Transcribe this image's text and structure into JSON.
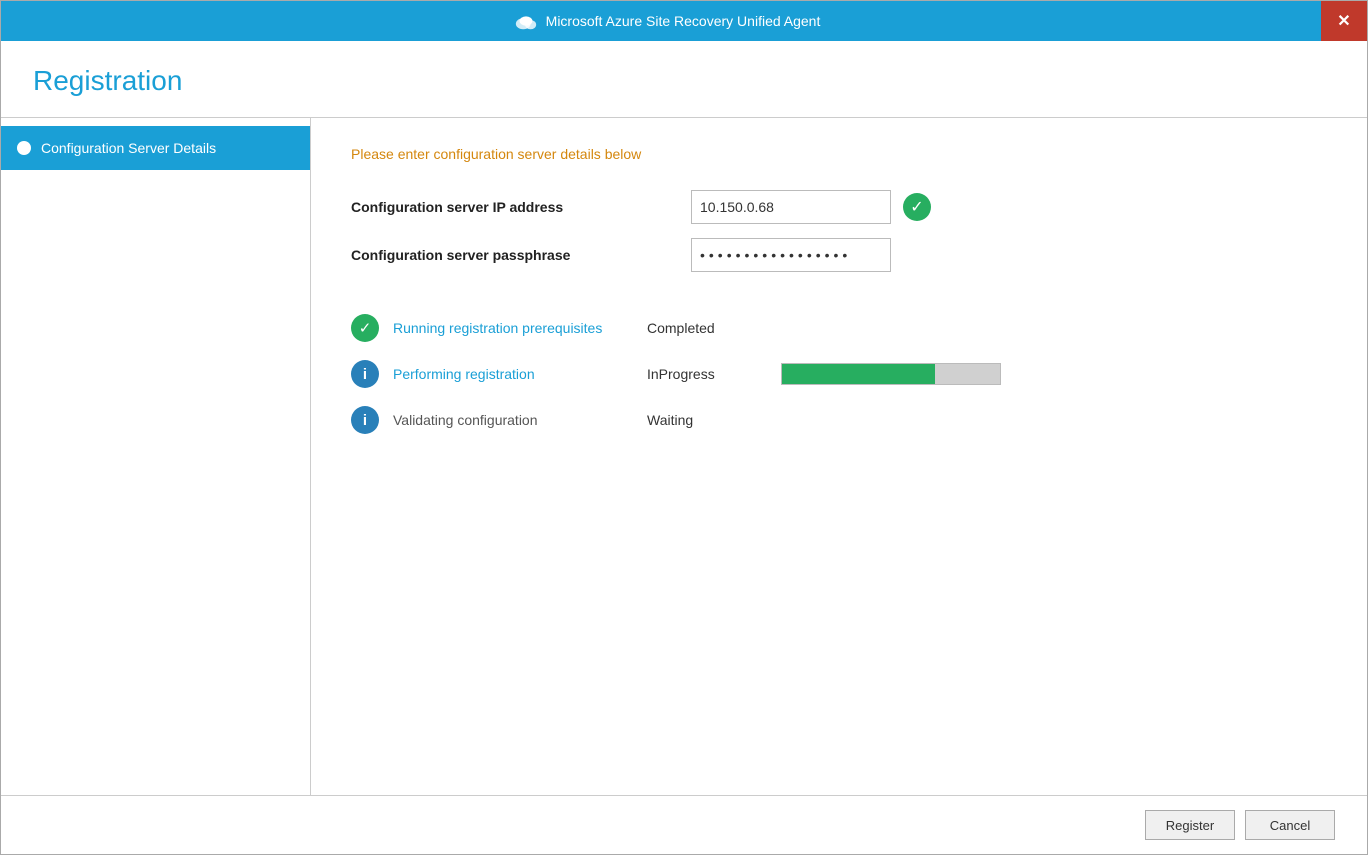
{
  "window": {
    "title": "Microsoft Azure Site Recovery Unified Agent"
  },
  "header": {
    "title": "Registration"
  },
  "sidebar": {
    "items": [
      {
        "id": "configuration-server-details",
        "label": "Configuration Server Details",
        "active": true
      }
    ]
  },
  "main": {
    "intro_text": "Please enter configuration server details below",
    "fields": {
      "ip_label": "Configuration server IP address",
      "ip_value": "10.150.0.68",
      "passphrase_label": "Configuration server passphrase",
      "passphrase_value": "••••••••••••••••"
    },
    "status_items": [
      {
        "icon_type": "green-check",
        "label": "Running registration prerequisites",
        "status": "Completed",
        "has_progress": false
      },
      {
        "icon_type": "blue-info",
        "label": "Performing registration",
        "status": "InProgress",
        "has_progress": true,
        "progress_percent": 70
      },
      {
        "icon_type": "blue-info",
        "label": "Validating configuration",
        "status": "Waiting",
        "has_progress": false
      }
    ]
  },
  "footer": {
    "register_label": "Register",
    "cancel_label": "Cancel"
  }
}
